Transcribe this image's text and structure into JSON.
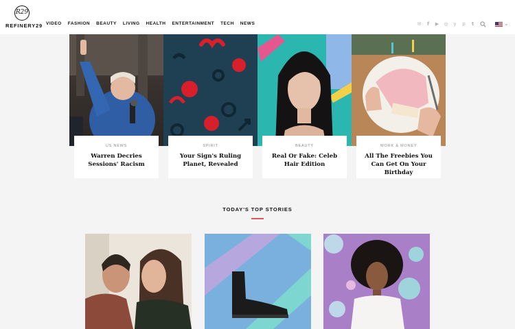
{
  "header": {
    "logo_text": "REFINERY29",
    "logo_mark": "R29",
    "nav": [
      "VIDEO",
      "FASHION",
      "BEAUTY",
      "LIVING",
      "HEALTH",
      "ENTERTAINMENT",
      "TECH",
      "NEWS"
    ],
    "social_icons": [
      "email-icon",
      "facebook-icon",
      "youtube-icon",
      "instagram-icon",
      "twitter-icon",
      "pinterest-icon",
      "tumblr-icon"
    ],
    "locale": "us-flag-icon"
  },
  "features": [
    {
      "category": "US NEWS",
      "title": "Warren Decries Sessions' Racism"
    },
    {
      "category": "SPIRIT",
      "title": "Your Sign's Ruling Planet, Revealed"
    },
    {
      "category": "BEAUTY",
      "title": "Real Or Fake: Celeb Hair Edition"
    },
    {
      "category": "WORK & MONEY",
      "title": "All The Freebies You Can Get On Your Birthday"
    }
  ],
  "top_stories": {
    "heading": "TODAY'S TOP STORIES"
  },
  "colors": {
    "accent": "#e2565a",
    "background": "#f4f4f4",
    "header_bg": "#ffffff"
  }
}
